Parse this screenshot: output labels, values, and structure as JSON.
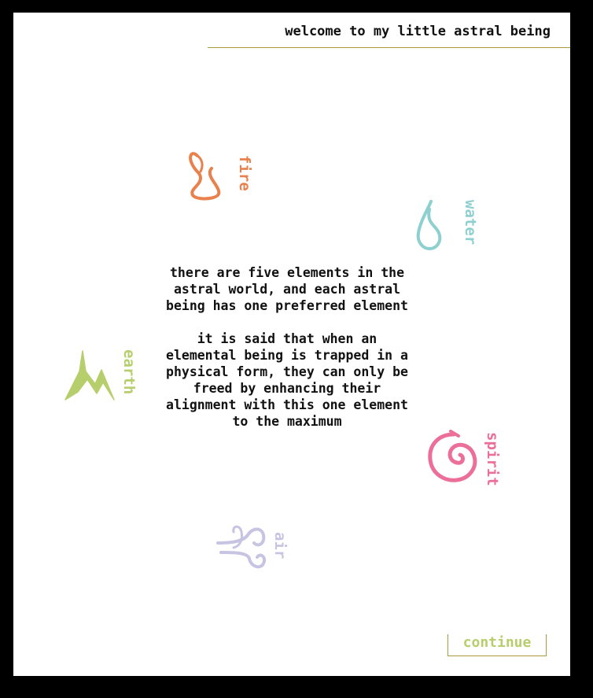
{
  "header": {
    "title": "welcome to my little astral being"
  },
  "intro": {
    "paragraph_1": "there are five elements in the astral world, and each astral being has one preferred element",
    "paragraph_2": "it is said that when an elemental being is trapped in a physical form, they can only be freed by enhancing their alignment with this one element to the maximum"
  },
  "elements": {
    "fire": {
      "label": "fire",
      "icon": "fire-icon",
      "color": "#e8814c"
    },
    "water": {
      "label": "water",
      "icon": "water-drop-icon",
      "color": "#8ecfcf"
    },
    "earth": {
      "label": "earth",
      "icon": "mountain-icon",
      "color": "#b6ce6c"
    },
    "spirit": {
      "label": "spirit",
      "icon": "spiral-icon",
      "color": "#ec6f9a"
    },
    "air": {
      "label": "air",
      "icon": "wind-icon",
      "color": "#c7c3e2"
    }
  },
  "continue_button": {
    "label": "continue",
    "color": "#b6ce6c",
    "border_color": "#a89a3a"
  },
  "colors": {
    "background": "#ffffff",
    "frame": "#000000",
    "text": "#111111",
    "rule": "#a89a3a"
  }
}
